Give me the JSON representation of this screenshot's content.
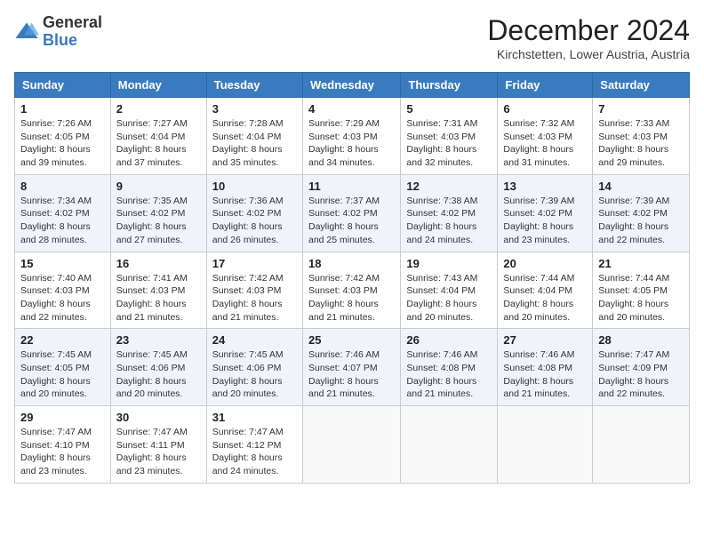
{
  "logo": {
    "general": "General",
    "blue": "Blue"
  },
  "header": {
    "month": "December 2024",
    "location": "Kirchstetten, Lower Austria, Austria"
  },
  "weekdays": [
    "Sunday",
    "Monday",
    "Tuesday",
    "Wednesday",
    "Thursday",
    "Friday",
    "Saturday"
  ],
  "weeks": [
    [
      {
        "day": "1",
        "sunrise": "7:26 AM",
        "sunset": "4:05 PM",
        "daylight": "8 hours and 39 minutes."
      },
      {
        "day": "2",
        "sunrise": "7:27 AM",
        "sunset": "4:04 PM",
        "daylight": "8 hours and 37 minutes."
      },
      {
        "day": "3",
        "sunrise": "7:28 AM",
        "sunset": "4:04 PM",
        "daylight": "8 hours and 35 minutes."
      },
      {
        "day": "4",
        "sunrise": "7:29 AM",
        "sunset": "4:03 PM",
        "daylight": "8 hours and 34 minutes."
      },
      {
        "day": "5",
        "sunrise": "7:31 AM",
        "sunset": "4:03 PM",
        "daylight": "8 hours and 32 minutes."
      },
      {
        "day": "6",
        "sunrise": "7:32 AM",
        "sunset": "4:03 PM",
        "daylight": "8 hours and 31 minutes."
      },
      {
        "day": "7",
        "sunrise": "7:33 AM",
        "sunset": "4:03 PM",
        "daylight": "8 hours and 29 minutes."
      }
    ],
    [
      {
        "day": "8",
        "sunrise": "7:34 AM",
        "sunset": "4:02 PM",
        "daylight": "8 hours and 28 minutes."
      },
      {
        "day": "9",
        "sunrise": "7:35 AM",
        "sunset": "4:02 PM",
        "daylight": "8 hours and 27 minutes."
      },
      {
        "day": "10",
        "sunrise": "7:36 AM",
        "sunset": "4:02 PM",
        "daylight": "8 hours and 26 minutes."
      },
      {
        "day": "11",
        "sunrise": "7:37 AM",
        "sunset": "4:02 PM",
        "daylight": "8 hours and 25 minutes."
      },
      {
        "day": "12",
        "sunrise": "7:38 AM",
        "sunset": "4:02 PM",
        "daylight": "8 hours and 24 minutes."
      },
      {
        "day": "13",
        "sunrise": "7:39 AM",
        "sunset": "4:02 PM",
        "daylight": "8 hours and 23 minutes."
      },
      {
        "day": "14",
        "sunrise": "7:39 AM",
        "sunset": "4:02 PM",
        "daylight": "8 hours and 22 minutes."
      }
    ],
    [
      {
        "day": "15",
        "sunrise": "7:40 AM",
        "sunset": "4:03 PM",
        "daylight": "8 hours and 22 minutes."
      },
      {
        "day": "16",
        "sunrise": "7:41 AM",
        "sunset": "4:03 PM",
        "daylight": "8 hours and 21 minutes."
      },
      {
        "day": "17",
        "sunrise": "7:42 AM",
        "sunset": "4:03 PM",
        "daylight": "8 hours and 21 minutes."
      },
      {
        "day": "18",
        "sunrise": "7:42 AM",
        "sunset": "4:03 PM",
        "daylight": "8 hours and 21 minutes."
      },
      {
        "day": "19",
        "sunrise": "7:43 AM",
        "sunset": "4:04 PM",
        "daylight": "8 hours and 20 minutes."
      },
      {
        "day": "20",
        "sunrise": "7:44 AM",
        "sunset": "4:04 PM",
        "daylight": "8 hours and 20 minutes."
      },
      {
        "day": "21",
        "sunrise": "7:44 AM",
        "sunset": "4:05 PM",
        "daylight": "8 hours and 20 minutes."
      }
    ],
    [
      {
        "day": "22",
        "sunrise": "7:45 AM",
        "sunset": "4:05 PM",
        "daylight": "8 hours and 20 minutes."
      },
      {
        "day": "23",
        "sunrise": "7:45 AM",
        "sunset": "4:06 PM",
        "daylight": "8 hours and 20 minutes."
      },
      {
        "day": "24",
        "sunrise": "7:45 AM",
        "sunset": "4:06 PM",
        "daylight": "8 hours and 20 minutes."
      },
      {
        "day": "25",
        "sunrise": "7:46 AM",
        "sunset": "4:07 PM",
        "daylight": "8 hours and 21 minutes."
      },
      {
        "day": "26",
        "sunrise": "7:46 AM",
        "sunset": "4:08 PM",
        "daylight": "8 hours and 21 minutes."
      },
      {
        "day": "27",
        "sunrise": "7:46 AM",
        "sunset": "4:08 PM",
        "daylight": "8 hours and 21 minutes."
      },
      {
        "day": "28",
        "sunrise": "7:47 AM",
        "sunset": "4:09 PM",
        "daylight": "8 hours and 22 minutes."
      }
    ],
    [
      {
        "day": "29",
        "sunrise": "7:47 AM",
        "sunset": "4:10 PM",
        "daylight": "8 hours and 23 minutes."
      },
      {
        "day": "30",
        "sunrise": "7:47 AM",
        "sunset": "4:11 PM",
        "daylight": "8 hours and 23 minutes."
      },
      {
        "day": "31",
        "sunrise": "7:47 AM",
        "sunset": "4:12 PM",
        "daylight": "8 hours and 24 minutes."
      },
      null,
      null,
      null,
      null
    ]
  ],
  "labels": {
    "sunrise": "Sunrise:",
    "sunset": "Sunset:",
    "daylight": "Daylight:"
  }
}
